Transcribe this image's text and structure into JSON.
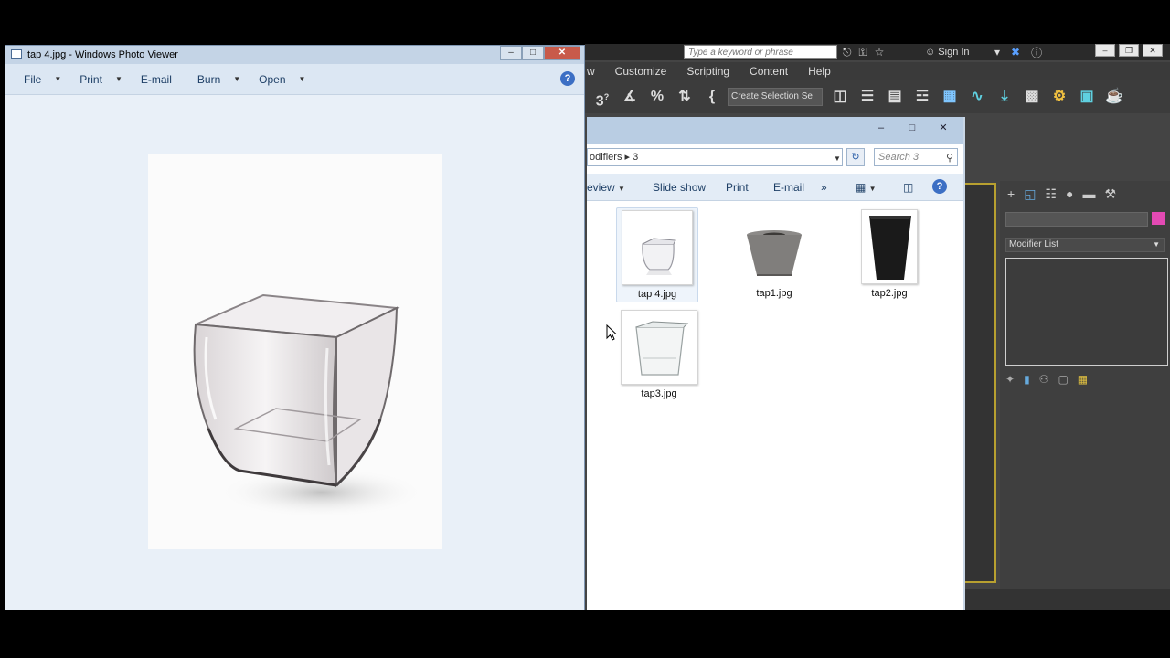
{
  "max": {
    "search_placeholder": "Type a keyword or phrase",
    "sign_in": "Sign In",
    "menu": [
      "Customize",
      "Scripting",
      "Content",
      "Help"
    ],
    "selection_set": "Create Selection Se",
    "modifier_list": "Modifier List",
    "name_color": "#e34ab4"
  },
  "viewer": {
    "title": "tap 4.jpg - Windows Photo Viewer",
    "menu": {
      "file": "File",
      "print": "Print",
      "email": "E-mail",
      "burn": "Burn",
      "open": "Open"
    },
    "help": "?"
  },
  "explorer": {
    "breadcrumb": "odifiers ▸ 3",
    "search_placeholder": "Search 3",
    "commands": {
      "preview": "eview",
      "slideshow": "Slide show",
      "print": "Print",
      "email": "E-mail",
      "more": "»"
    },
    "files": [
      {
        "name": "tap 4.jpg",
        "selected": true
      },
      {
        "name": "tap1.jpg",
        "selected": false
      },
      {
        "name": "tap2.jpg",
        "selected": false
      },
      {
        "name": "tap3.jpg",
        "selected": false
      }
    ]
  }
}
